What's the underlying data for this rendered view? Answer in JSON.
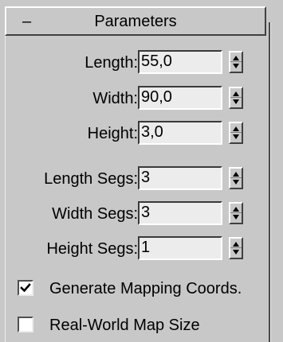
{
  "rollout": {
    "collapse_symbol": "–",
    "title": "Parameters"
  },
  "params": [
    {
      "label": "Length:",
      "value": "55,0"
    },
    {
      "label": "Width:",
      "value": "90,0"
    },
    {
      "label": "Height:",
      "value": "3,0"
    },
    {
      "label": "Length Segs:",
      "value": "3"
    },
    {
      "label": "Width Segs:",
      "value": "3"
    },
    {
      "label": "Height Segs:",
      "value": "1"
    }
  ],
  "options": [
    {
      "label": "Generate Mapping Coords.",
      "checked": true
    },
    {
      "label": "Real-World Map Size",
      "checked": false
    }
  ]
}
